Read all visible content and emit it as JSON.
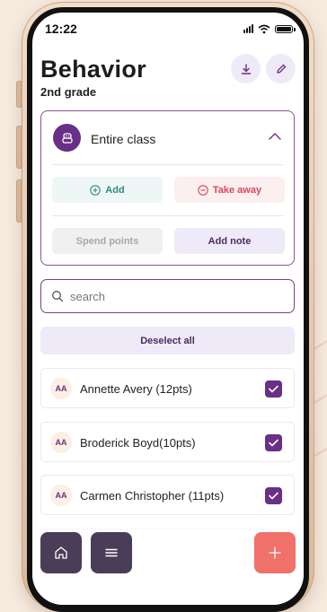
{
  "status_bar": {
    "time": "12:22"
  },
  "header": {
    "title": "Behavior",
    "subtitle": "2nd grade",
    "download_icon": "download-icon",
    "edit_icon": "pencil-icon"
  },
  "class_card": {
    "label": "Entire class",
    "icon": "group-icon",
    "add_label": "Add",
    "take_away_label": "Take away",
    "spend_points_label": "Spend points",
    "add_note_label": "Add note"
  },
  "search": {
    "placeholder": "search"
  },
  "deselect_label": "Deselect all",
  "students": [
    {
      "initials": "AA",
      "name": "Annette Avery (12pts)",
      "checked": true
    },
    {
      "initials": "AA",
      "name": "Broderick Boyd(10pts)",
      "checked": true
    },
    {
      "initials": "AA",
      "name": "Carmen Christopher (11pts)",
      "checked": true
    }
  ],
  "bottom_nav": {
    "home_icon": "home-icon",
    "menu_icon": "menu-icon",
    "add_icon": "plus-icon"
  },
  "colors": {
    "accent": "#6a2f86",
    "accent_light": "#efeaf7",
    "add_green": "#2f8a7d",
    "take_away_red": "#d9475a",
    "fab": "#f0706a",
    "nav_dark": "#4a3d57"
  }
}
